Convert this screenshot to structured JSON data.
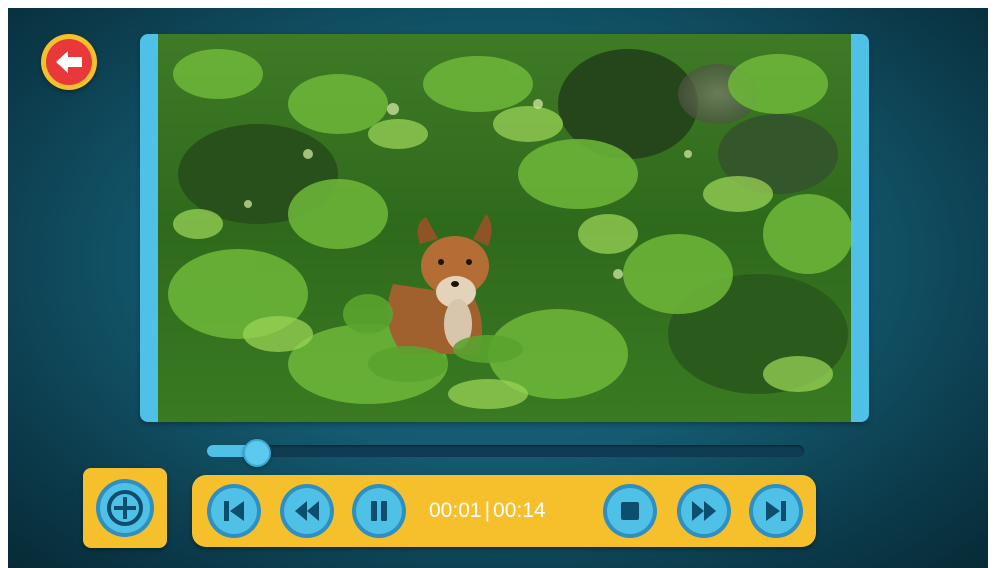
{
  "player": {
    "current_time": "00:01",
    "separator": "|",
    "duration": "00:14",
    "progress_fraction": 0.08
  },
  "icons": {
    "back": "back-arrow-icon",
    "add": "plus-circle-icon",
    "skip_start": "skip-to-start-icon",
    "rewind": "rewind-icon",
    "pause": "pause-icon",
    "stop": "stop-icon",
    "fast_forward": "fast-forward-icon",
    "skip_end": "skip-to-end-icon"
  },
  "colors": {
    "accent_yellow": "#f5c02b",
    "button_blue": "#4fc0e6",
    "icon_navy": "#0d4d6e",
    "back_red": "#e8383a",
    "background_teal": "#145a70"
  }
}
